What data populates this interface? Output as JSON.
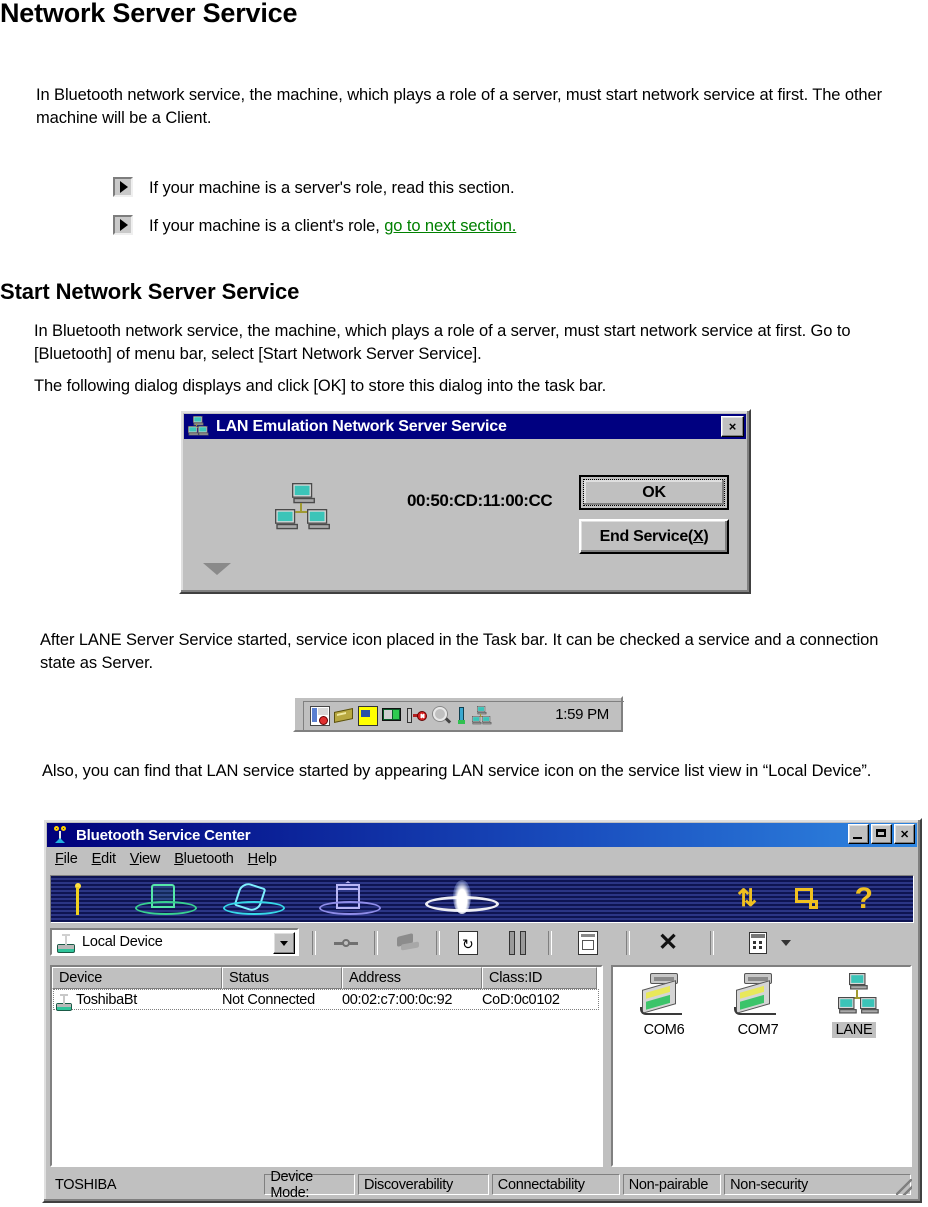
{
  "doc": {
    "h1": "Network Server Service",
    "intro": "In Bluetooth network service, the machine, which plays a role of a server, must start network service at first. The other machine will be a Client.",
    "bullet1": "If your machine is a server's role, read this section.",
    "bullet2_prefix": "If your machine is a client's role, ",
    "bullet2_link": "go to next section.",
    "h2": "Start Network Server Service",
    "p2": "In Bluetooth network service, the machine, which plays a role of a server, must start network service at first. Go to [Bluetooth] of menu bar, select [Start Network Server Service].",
    "p3": "The following dialog displays and click [OK] to store this dialog into the task bar.",
    "p4": "After LANE Server Service started, service icon placed in the Task bar.  It can be checked a service and a connection state as Server.",
    "p5": "Also, you can find that LAN service started by appearing LAN service icon on the service list view in “Local Device”.",
    "link_color": "#008000"
  },
  "dialog": {
    "title": "LAN Emulation Network Server Service",
    "title_icon": "network-computers-icon",
    "close_label": "×",
    "mac_address": "00:50:CD:11:00:CC",
    "ok_label": "OK",
    "end_service_label": "End Service(X)",
    "end_service_accel": "X",
    "expand_icon": "triangle-down-icon",
    "titlebar_color": "#000080",
    "face_color": "#c0c0c0"
  },
  "tray": {
    "time": "1:59 PM",
    "icons": [
      "schedule-clock-icon",
      "pcmcia-card-icon",
      "yellow-note-icon",
      "network-monitor-icon",
      "plug-disconnect-icon",
      "bluetooth-search-icon",
      "antenna-icon",
      "lan-emulation-icon"
    ]
  },
  "bsc": {
    "title": "Bluetooth Service Center",
    "title_icon": "antenna-tower-icon",
    "window_buttons": [
      {
        "name": "minimize",
        "label": "_"
      },
      {
        "name": "maximize",
        "label": "□"
      },
      {
        "name": "close",
        "label": "×"
      }
    ],
    "menu": [
      {
        "label": "File",
        "accel": "F"
      },
      {
        "label": "Edit",
        "accel": "E"
      },
      {
        "label": "View",
        "accel": "V"
      },
      {
        "label": "Bluetooth",
        "accel": "B"
      },
      {
        "label": "Help",
        "accel": "H"
      }
    ],
    "toolbar_icons": [
      "antenna-pole-icon",
      "green-tower-icon",
      "cyan-shell-icon",
      "purple-house-icon",
      "white-glow-icon"
    ],
    "toolbar_right_icons": [
      "transfer-arrows-icon",
      "device-properties-icon",
      "help-question-icon"
    ],
    "combo": {
      "value": "Local Device",
      "icon": "local-device-icon",
      "arrow": "chevron-down-icon"
    },
    "buttons": [
      "connect-icon",
      "pair-icon",
      "refresh-icon",
      "search-devices-icon",
      "device-info-icon",
      "disconnect-x-icon",
      "view-list-icon",
      "view-dropdown-arrow-icon"
    ],
    "list": {
      "columns": [
        "Device",
        "Status",
        "Address",
        "Class:ID"
      ],
      "rows": [
        {
          "icon": "local-device-icon",
          "device": "ToshibaBt",
          "status": "Not Connected",
          "address": "00:02:c7:00:0c:92",
          "classid": "CoD:0c0102"
        }
      ]
    },
    "services": [
      {
        "label": "COM6",
        "icon": "serial-port-icon",
        "selected": false
      },
      {
        "label": "COM7",
        "icon": "serial-port-icon",
        "selected": false
      },
      {
        "label": "LANE",
        "icon": "lan-emulation-icon",
        "selected": true
      }
    ],
    "status": {
      "vendor": "TOSHIBA",
      "device_mode_label": "Device Mode:",
      "discoverability": "Discoverability",
      "connectability": "Connectability",
      "pairable": "Non-pairable",
      "security": "Non-security"
    }
  }
}
